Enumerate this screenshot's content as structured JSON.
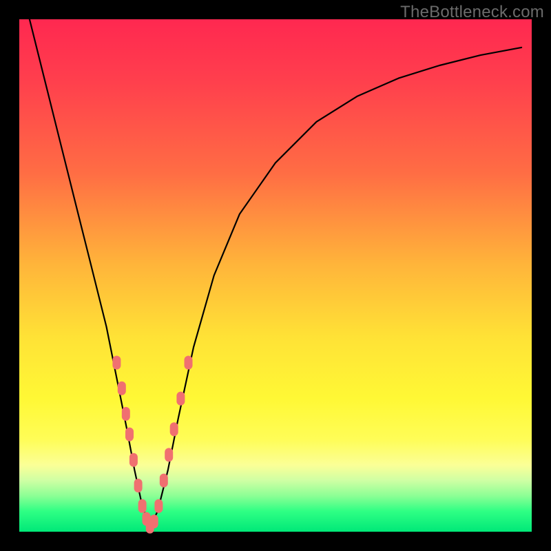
{
  "watermark": "TheBottleneck.com",
  "chart_data": {
    "type": "line",
    "title": "",
    "xlabel": "",
    "ylabel": "",
    "xlim": [
      0,
      100
    ],
    "ylim": [
      0,
      100
    ],
    "grid": false,
    "legend": false,
    "series": [
      {
        "name": "bottleneck-curve",
        "x": [
          2,
          5,
          8,
          11,
          14,
          17,
          19,
          21,
          22.5,
          24,
          25.5,
          27,
          29,
          31,
          34,
          38,
          43,
          50,
          58,
          66,
          74,
          82,
          90,
          98
        ],
        "y": [
          100,
          88,
          76,
          64,
          52,
          40,
          30,
          20,
          12,
          5,
          1,
          4,
          12,
          22,
          36,
          50,
          62,
          72,
          80,
          85,
          88.5,
          91,
          93,
          94.5
        ]
      }
    ],
    "markers": [
      {
        "branch": "left",
        "x": 19.0,
        "y": 33
      },
      {
        "branch": "left",
        "x": 20.0,
        "y": 28
      },
      {
        "branch": "left",
        "x": 20.8,
        "y": 23
      },
      {
        "branch": "left",
        "x": 21.5,
        "y": 19
      },
      {
        "branch": "left",
        "x": 22.3,
        "y": 14
      },
      {
        "branch": "left",
        "x": 23.2,
        "y": 9
      },
      {
        "branch": "left",
        "x": 24.0,
        "y": 5
      },
      {
        "branch": "left",
        "x": 24.8,
        "y": 2.5
      },
      {
        "branch": "left",
        "x": 25.5,
        "y": 1
      },
      {
        "branch": "right",
        "x": 26.3,
        "y": 2
      },
      {
        "branch": "right",
        "x": 27.2,
        "y": 5
      },
      {
        "branch": "right",
        "x": 28.2,
        "y": 10
      },
      {
        "branch": "right",
        "x": 29.2,
        "y": 15
      },
      {
        "branch": "right",
        "x": 30.2,
        "y": 20
      },
      {
        "branch": "right",
        "x": 31.5,
        "y": 26
      },
      {
        "branch": "right",
        "x": 33.0,
        "y": 33
      }
    ],
    "colors": {
      "curve": "#000000",
      "markers": "#f07070",
      "gradient_top": "#ff2850",
      "gradient_bottom": "#00e878"
    }
  }
}
